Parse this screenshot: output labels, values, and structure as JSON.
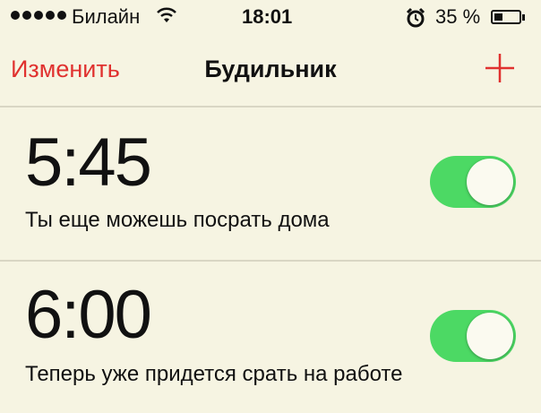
{
  "status_bar": {
    "carrier": "Билайн",
    "time": "18:01",
    "battery": "35 %",
    "battery_level": 0.35,
    "signal_icon": "signal-dots-icon",
    "wifi_icon": "wifi-icon",
    "alarm_icon": "alarm-clock-icon"
  },
  "nav": {
    "edit_label": "Изменить",
    "title": "Будильник",
    "add_icon": "plus-icon"
  },
  "colors": {
    "accent": "#e0312f",
    "toggle_on": "#4cd964",
    "background": "#f6f4e2"
  },
  "alarms": [
    {
      "time": "5:45",
      "label": "Ты еще можешь посрать дома",
      "enabled": true
    },
    {
      "time": "6:00",
      "label": "Теперь уже придется срать на работе",
      "enabled": true
    }
  ]
}
